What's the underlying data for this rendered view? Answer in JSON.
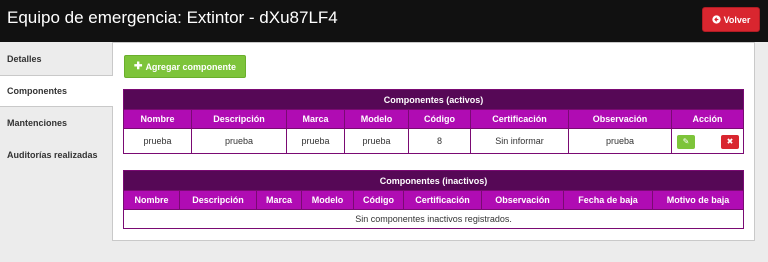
{
  "header": {
    "title": "Equipo de emergencia: Extintor - dXu87LF4",
    "back_label": "Volver"
  },
  "sidebar": {
    "items": [
      {
        "label": "Detalles"
      },
      {
        "label": "Componentes"
      },
      {
        "label": "Mantenciones"
      },
      {
        "label": "Auditorías realizadas"
      }
    ]
  },
  "main": {
    "add_button_label": "Agregar componente",
    "active": {
      "caption": "Componentes (activos)",
      "columns": [
        "Nombre",
        "Descripción",
        "Marca",
        "Modelo",
        "Código",
        "Certificación",
        "Observación",
        "Acción"
      ],
      "rows": [
        {
          "nombre": "prueba",
          "descripcion": "prueba",
          "marca": "prueba",
          "modelo": "prueba",
          "codigo": "8",
          "certificacion": "Sin informar",
          "observacion": "prueba"
        }
      ]
    },
    "inactive": {
      "caption": "Componentes (inactivos)",
      "columns": [
        "Nombre",
        "Descripción",
        "Marca",
        "Modelo",
        "Código",
        "Certificación",
        "Observación",
        "Fecha de baja",
        "Motivo de baja"
      ],
      "empty_message": "Sin componentes inactivos registrados."
    }
  },
  "colors": {
    "caption_bg": "#560856",
    "header_bg": "#b00cb3",
    "add_button": "#7dc43a",
    "back_button": "#d9262f",
    "topbar": "#111111"
  },
  "icons": {
    "back": "arrow-circle-left-icon",
    "add": "plus-icon",
    "edit": "pencil-icon",
    "delete": "x-icon"
  }
}
